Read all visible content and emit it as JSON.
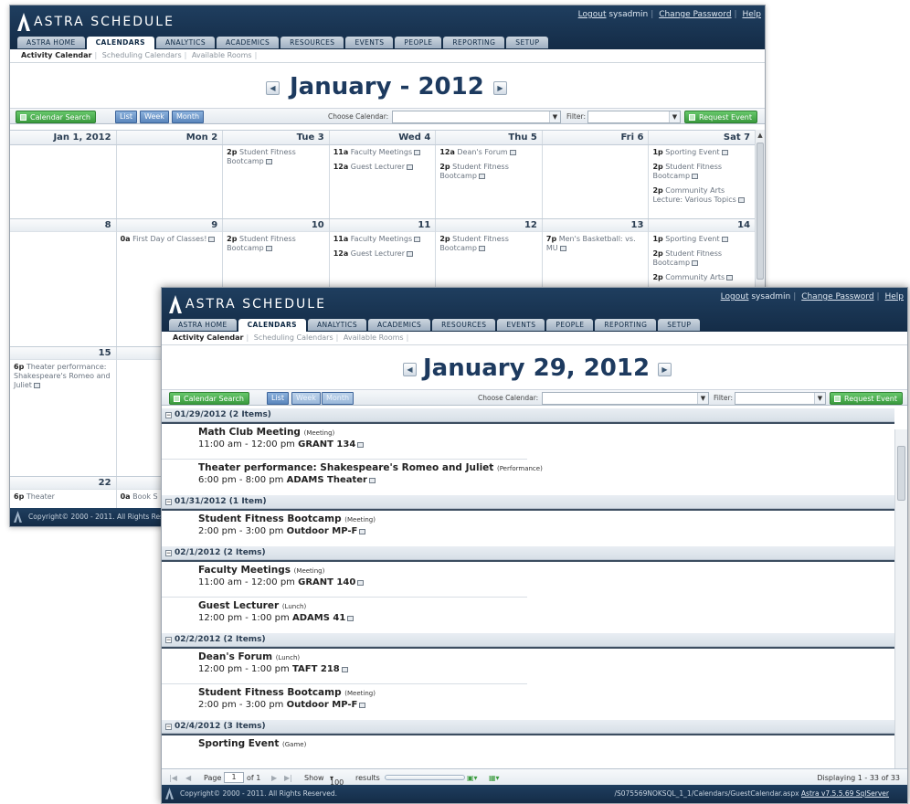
{
  "app": {
    "name": "ASTRA SCHEDULE"
  },
  "toplinks": {
    "logout": "Logout",
    "user": "sysadmin",
    "change_password": "Change Password",
    "help": "Help"
  },
  "tabs": [
    "ASTRA HOME",
    "CALENDARS",
    "ANALYTICS",
    "ACADEMICS",
    "RESOURCES",
    "EVENTS",
    "PEOPLE",
    "REPORTING",
    "SETUP"
  ],
  "active_tab": "CALENDARS",
  "subnav": [
    "Activity Calendar",
    "Scheduling Calendars",
    "Available Rooms"
  ],
  "toolbar": {
    "search": "Calendar Search",
    "list": "List",
    "week": "Week",
    "month": "Month",
    "choose_calendar": "Choose Calendar:",
    "filter": "Filter:",
    "request": "Request Event"
  },
  "month_view": {
    "title": "January - 2012",
    "headers": [
      "Jan 1, 2012",
      "Mon 2",
      "Tue 3",
      "Wed 4",
      "Thu 5",
      "Fri 6",
      "Sat 7"
    ],
    "week1": [
      [],
      [],
      [
        {
          "t": "2p",
          "n": "Student Fitness Bootcamp"
        }
      ],
      [
        {
          "t": "11a",
          "n": "Faculty Meetings"
        },
        {
          "t": "12a",
          "n": "Guest Lecturer"
        }
      ],
      [
        {
          "t": "12a",
          "n": "Dean's Forum"
        },
        {
          "t": "2p",
          "n": "Student Fitness Bootcamp"
        }
      ],
      [],
      [
        {
          "t": "1p",
          "n": "Sporting Event"
        },
        {
          "t": "2p",
          "n": "Student Fitness Bootcamp"
        },
        {
          "t": "2p",
          "n": "Community Arts Lecture: Various Topics"
        }
      ]
    ],
    "week2_days": [
      "8",
      "9",
      "10",
      "11",
      "12",
      "13",
      "14"
    ],
    "week2": [
      [],
      [
        {
          "t": "0a",
          "n": "First Day of Classes!"
        }
      ],
      [
        {
          "t": "2p",
          "n": "Student Fitness Bootcamp"
        }
      ],
      [
        {
          "t": "11a",
          "n": "Faculty Meetings"
        },
        {
          "t": "12a",
          "n": "Guest Lecturer"
        }
      ],
      [
        {
          "t": "2p",
          "n": "Student Fitness Bootcamp"
        }
      ],
      [
        {
          "t": "7p",
          "n": "Men's Basketball: vs. MU"
        }
      ],
      [
        {
          "t": "1p",
          "n": "Sporting Event"
        },
        {
          "t": "2p",
          "n": "Student Fitness Bootcamp"
        },
        {
          "t": "2p",
          "n": "Community Arts"
        }
      ]
    ],
    "week3_day": "15",
    "week3_event": {
      "t": "6p",
      "n": "Theater performance: Shakespeare's Romeo and Juliet"
    },
    "week4_day": "22",
    "week4_events": [
      {
        "t": "6p",
        "n": "Theater"
      },
      {
        "t": "0a",
        "n": "Book S"
      }
    ],
    "footer": "Copyright© 2000 - 2011.   All Rights Res"
  },
  "list_view": {
    "title": "January 29, 2012",
    "groups": [
      {
        "date": "01/29/2012 (2 Items)",
        "items": [
          {
            "name": "Math Club Meeting",
            "type": "(Meeting)",
            "time": "11:00 am - 12:00 pm",
            "room": "GRANT 134"
          },
          {
            "name": "Theater performance: Shakespeare's Romeo and Juliet",
            "type": "(Performance)",
            "time": "6:00 pm - 8:00 pm",
            "room": "ADAMS Theater"
          }
        ]
      },
      {
        "date": "01/31/2012 (1 Item)",
        "items": [
          {
            "name": "Student Fitness Bootcamp",
            "type": "(Meeting)",
            "time": "2:00 pm - 3:00 pm",
            "room": "Outdoor MP-F"
          }
        ]
      },
      {
        "date": "02/1/2012 (2 Items)",
        "items": [
          {
            "name": "Faculty Meetings",
            "type": "(Meeting)",
            "time": "11:00 am - 12:00 pm",
            "room": "GRANT 140"
          },
          {
            "name": "Guest Lecturer",
            "type": "(Lunch)",
            "time": "12:00 pm - 1:00 pm",
            "room": "ADAMS 41"
          }
        ]
      },
      {
        "date": "02/2/2012 (2 Items)",
        "items": [
          {
            "name": "Dean's Forum",
            "type": "(Lunch)",
            "time": "12:00 pm - 1:00 pm",
            "room": "TAFT 218"
          },
          {
            "name": "Student Fitness Bootcamp",
            "type": "(Meeting)",
            "time": "2:00 pm - 3:00 pm",
            "room": "Outdoor MP-F"
          }
        ]
      },
      {
        "date": "02/4/2012 (3 Items)",
        "items": [
          {
            "name": "Sporting Event",
            "type": "(Game)",
            "time": "",
            "room": ""
          }
        ]
      }
    ],
    "pager": {
      "page_label": "Page",
      "page": "1",
      "of": "of 1",
      "show": "Show",
      "show_val": "100",
      "results": "results",
      "displaying": "Displaying 1 - 33 of 33"
    },
    "footer": "Copyright© 2000 - 2011.   All Rights Reserved.",
    "footer_path": "/S075569NOKSQL_1_1/Calendars/GuestCalendar.aspx",
    "footer_version": "Astra v7.5.5.69 SqlServer"
  }
}
